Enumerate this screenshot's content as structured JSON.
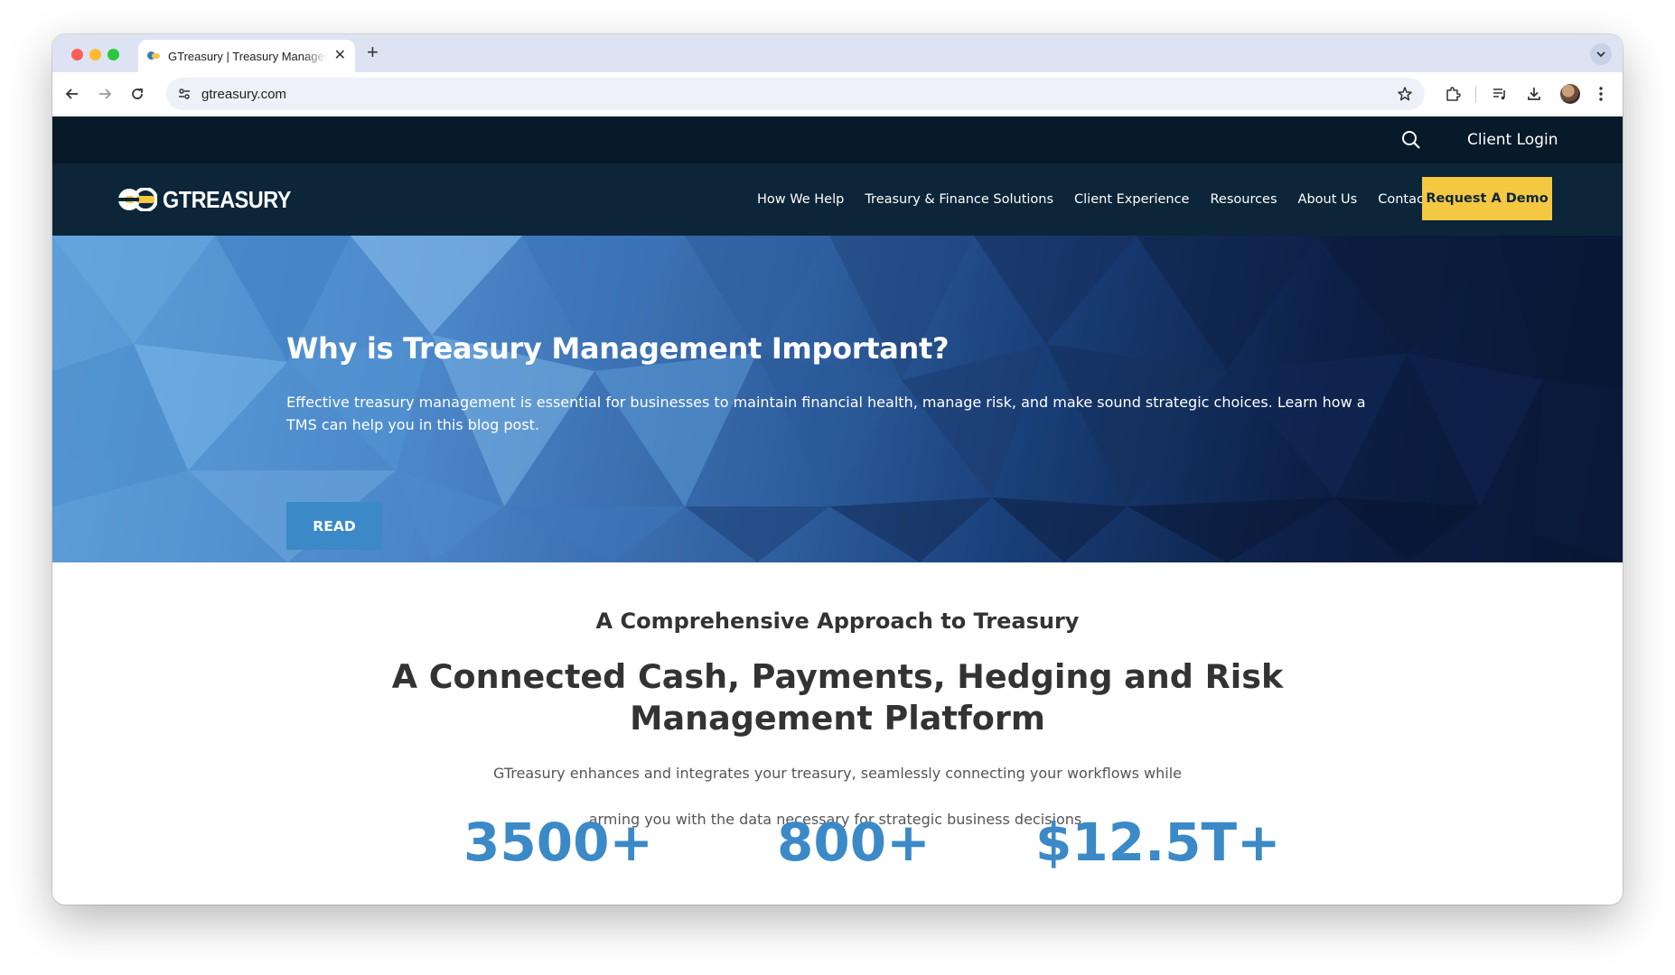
{
  "browser": {
    "tab_title": "GTreasury | Treasury Management",
    "url": "gtreasury.com"
  },
  "site": {
    "utility": {
      "client_login": "Client Login"
    },
    "logo_text": "GTREASURY",
    "nav": [
      "How We Help",
      "Treasury & Finance Solutions",
      "Client Experience",
      "Resources",
      "About Us",
      "Contact"
    ],
    "cta": "Request A Demo",
    "hero": {
      "title": "Why is Treasury Management Important?",
      "description": "Effective treasury management is essential for businesses to maintain financial health, manage risk, and make sound strategic choices. Learn how a TMS can help you in this blog post.",
      "button": "READ"
    },
    "section": {
      "subtitle": "A Comprehensive Approach to Treasury",
      "title": "A Connected Cash, Payments, Hedging and Risk Management Platform",
      "body_line1": "GTreasury enhances and integrates your treasury, seamlessly connecting your workflows while",
      "body_line2": "arming you with the data necessary for strategic business decisions."
    },
    "stats": [
      "3500+",
      "800+",
      "$12.5T+"
    ]
  },
  "colors": {
    "nav_bg": "#0c2539",
    "utility_bg": "#071a29",
    "cta_bg": "#f5c842",
    "accent_blue": "#3b8ac7"
  },
  "icons": {
    "tab_favicon": "gtreasury-favicon",
    "nav_back": "arrow-left-icon",
    "nav_forward": "arrow-right-icon",
    "reload": "reload-icon",
    "site_info": "tune-icon",
    "bookmark": "star-icon",
    "extensions": "puzzle-icon",
    "reading_list": "playlist-icon",
    "downloads": "download-icon",
    "menu": "kebab-icon",
    "search": "search-icon"
  }
}
